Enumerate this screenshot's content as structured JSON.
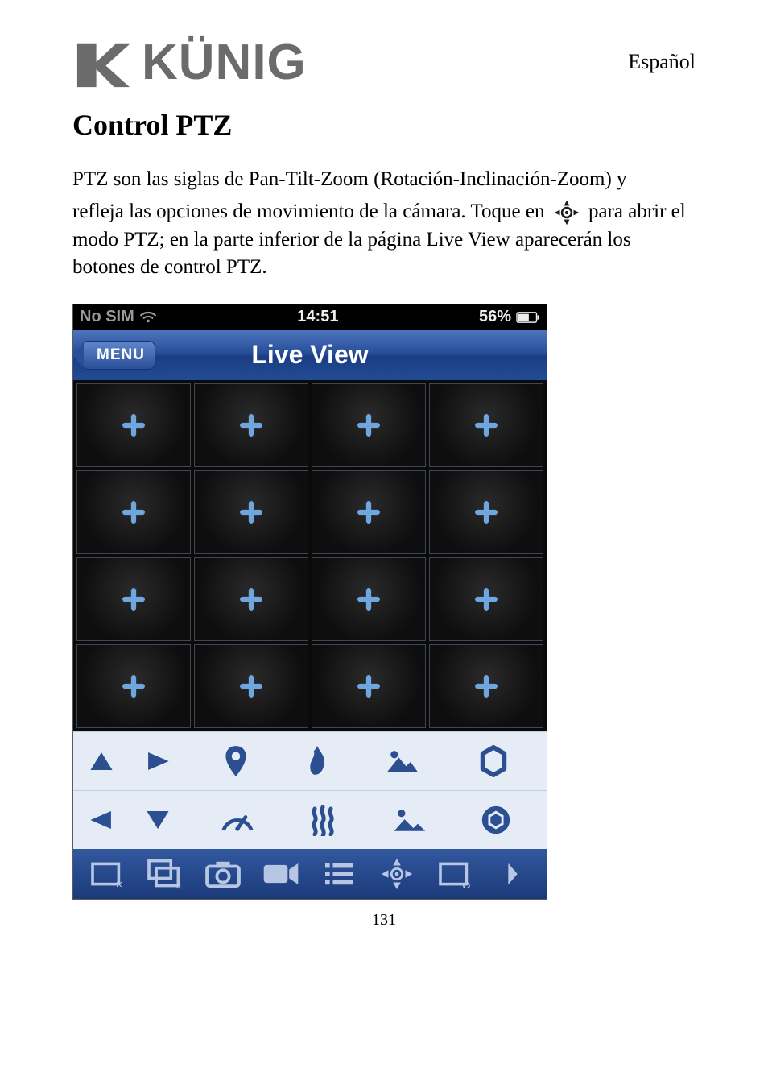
{
  "header": {
    "brand": "KÜNIG",
    "language": "Español"
  },
  "section": {
    "title": "Control PTZ",
    "para1": "PTZ son las siglas de Pan-Tilt-Zoom (Rotación-Inclinación-Zoom) y",
    "para2_pre": "refleja las opciones de movimiento de la cámara. Toque en ",
    "para2_post": " para abrir el modo PTZ; en la parte inferior de la página Live View aparecerán los botones de control PTZ."
  },
  "phone": {
    "status": {
      "carrier": "No SIM",
      "time": "14:51",
      "battery": "56%"
    },
    "nav": {
      "menu_label": "MENU",
      "title": "Live View"
    },
    "grid_cells": 16,
    "ptz_row1": [
      "arrow-up-icon",
      "arrow-right-play-icon",
      "pin-icon",
      "flame-icon",
      "image-sun-icon",
      "aperture-open-icon"
    ],
    "ptz_row2": [
      "arrow-left-icon",
      "arrow-down-icon",
      "speed-dial-icon",
      "heat-waves-icon",
      "image-dark-icon",
      "aperture-close-icon"
    ],
    "bottom_bar": [
      "single-view-close-icon",
      "multi-view-close-icon",
      "camera-snapshot-icon",
      "record-video-icon",
      "list-icon",
      "ptz-icon",
      "single-view-open-icon",
      "chevron-right-icon"
    ]
  },
  "page_number": "131"
}
